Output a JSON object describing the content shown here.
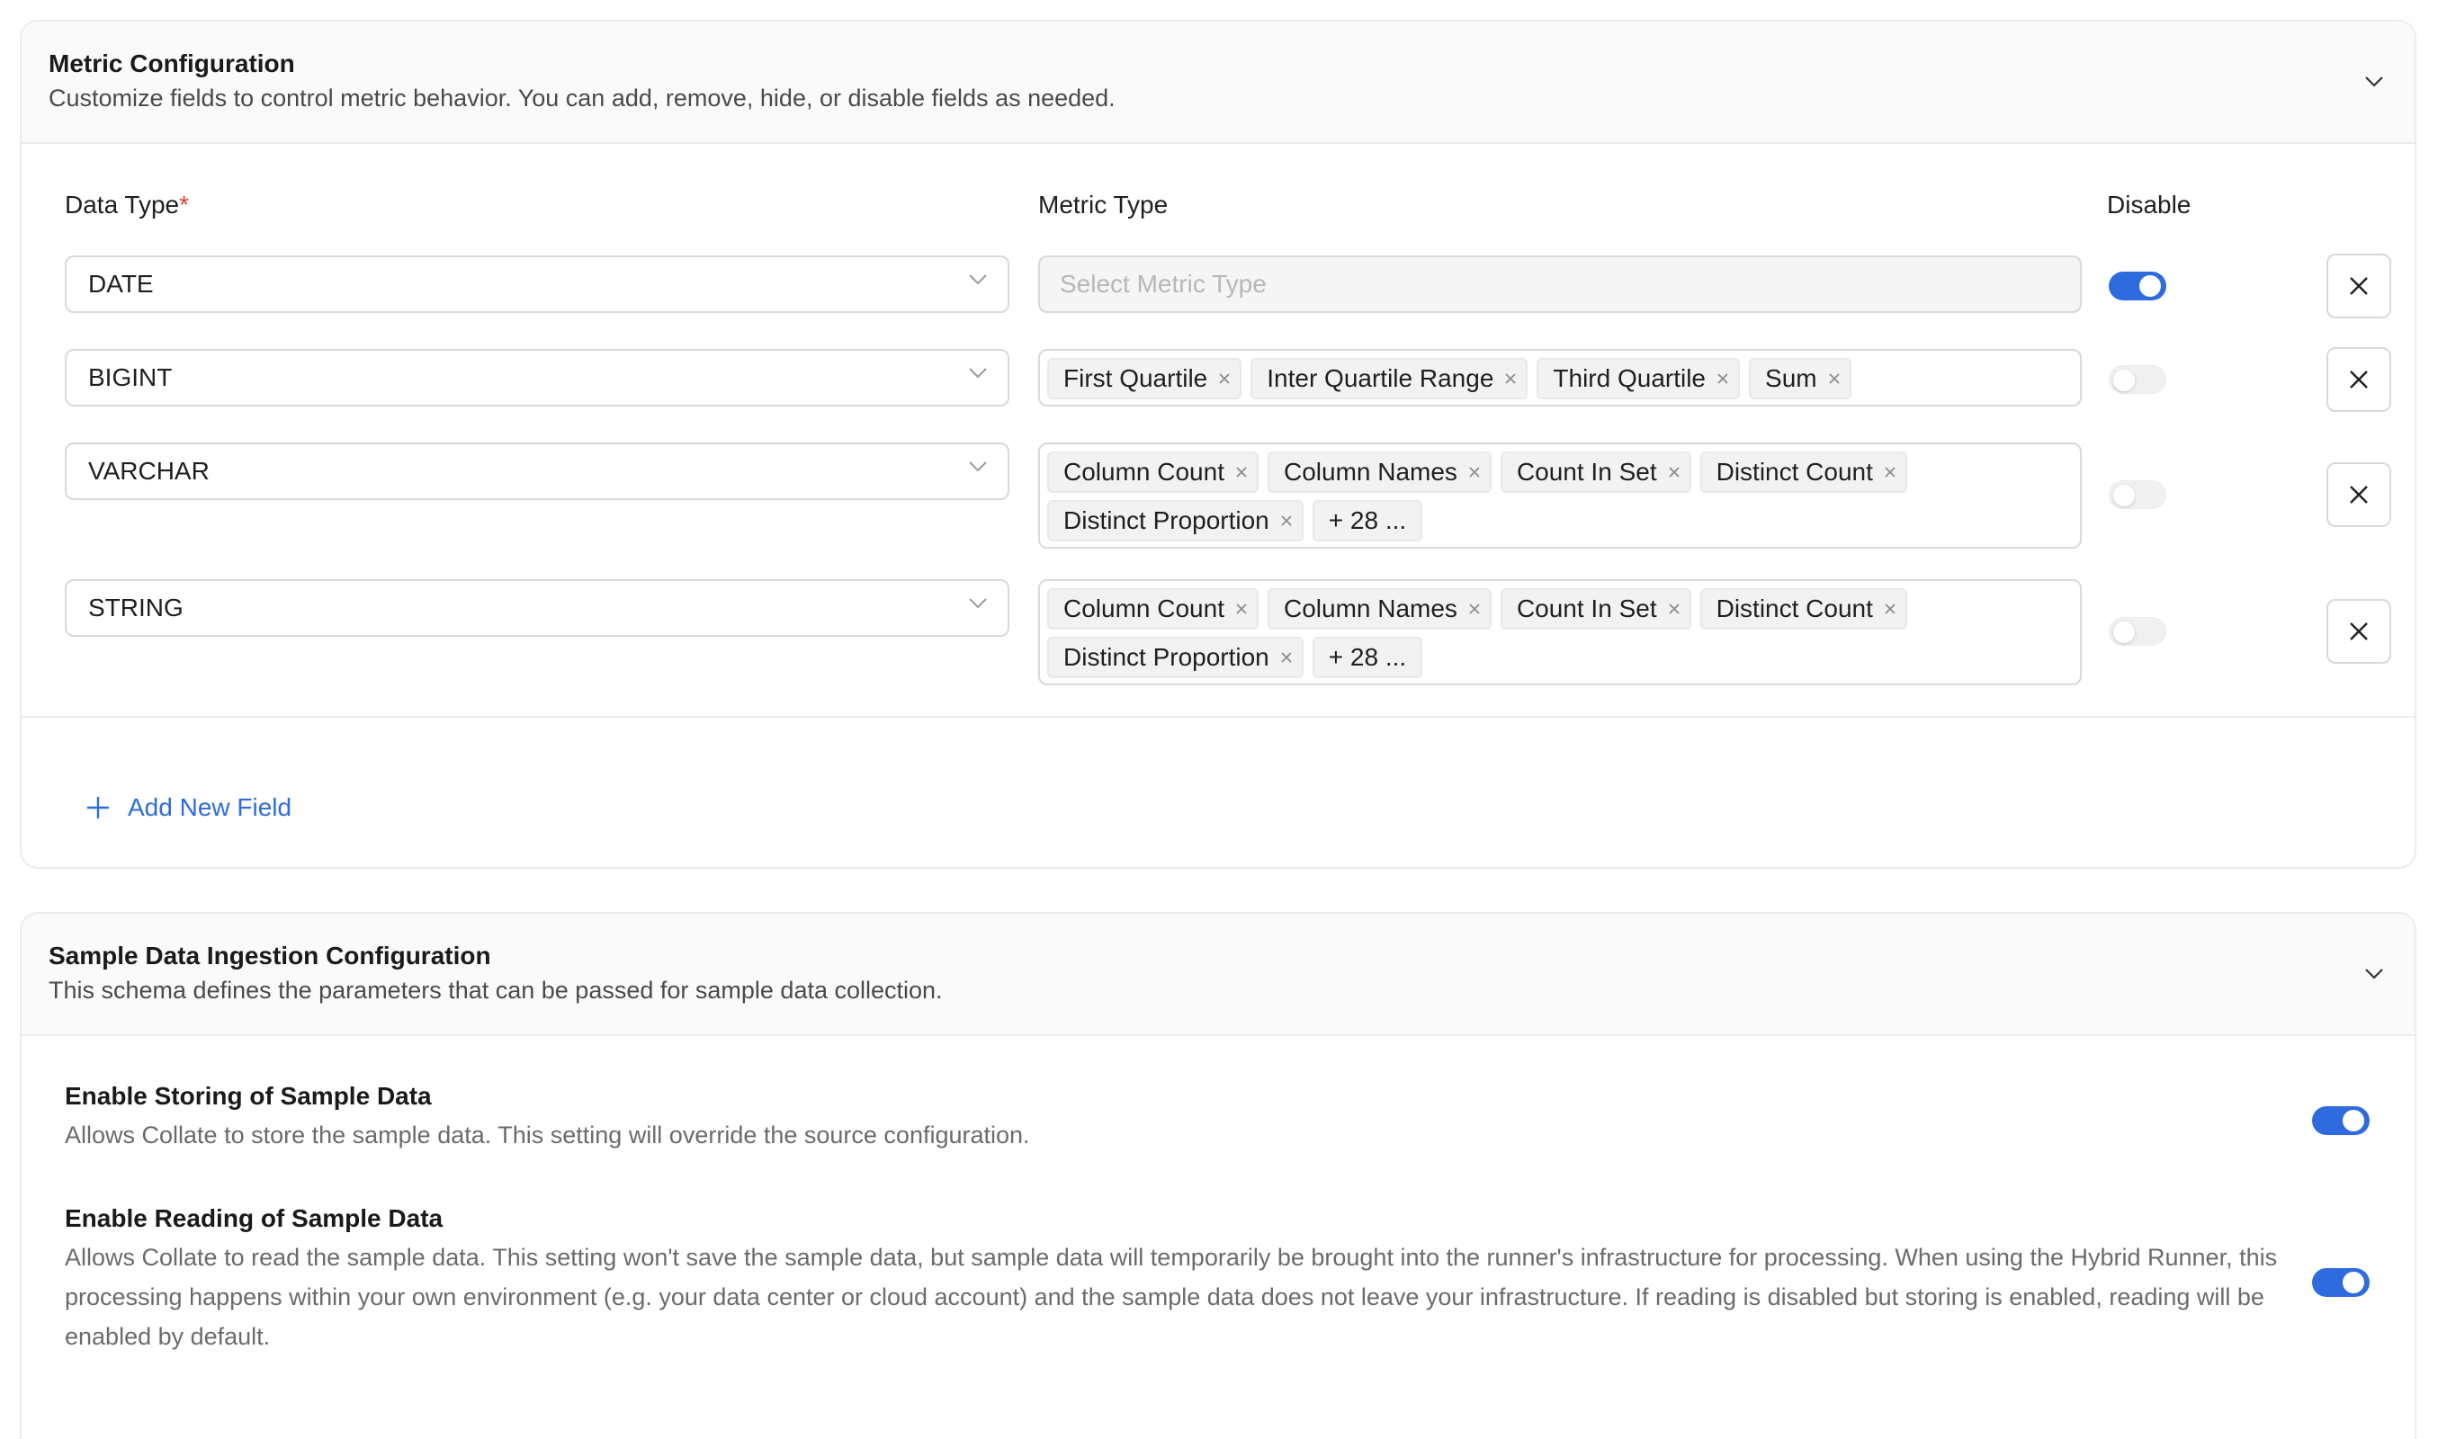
{
  "metric_config": {
    "title": "Metric Configuration",
    "description": "Customize fields to control metric behavior. You can add, remove, hide, or disable fields as needed.",
    "columns": {
      "data_type": "Data Type",
      "required_mark": "*",
      "metric_type": "Metric Type",
      "disable": "Disable"
    },
    "rows": [
      {
        "data_type": "DATE",
        "placeholder": "Select Metric Type",
        "tags": [],
        "more": "",
        "disabled": true
      },
      {
        "data_type": "BIGINT",
        "placeholder": "",
        "tags": [
          "First Quartile",
          "Inter Quartile Range",
          "Third Quartile",
          "Sum"
        ],
        "more": "",
        "disabled": false
      },
      {
        "data_type": "VARCHAR",
        "placeholder": "",
        "tags": [
          "Column Count",
          "Column Names",
          "Count In Set",
          "Distinct Count",
          "Distinct Proportion"
        ],
        "more": "+ 28 ...",
        "disabled": false
      },
      {
        "data_type": "STRING",
        "placeholder": "",
        "tags": [
          "Column Count",
          "Column Names",
          "Count In Set",
          "Distinct Count",
          "Distinct Proportion"
        ],
        "more": "+ 28 ...",
        "disabled": false
      }
    ],
    "add_field_label": "Add New Field"
  },
  "sample_config": {
    "title": "Sample Data Ingestion Configuration",
    "description": "This schema defines the parameters that can be passed for sample data collection.",
    "settings": [
      {
        "title": "Enable Storing of Sample Data",
        "description": "Allows Collate to store the sample data. This setting will override the source configuration.",
        "enabled": true
      },
      {
        "title": "Enable Reading of Sample Data",
        "description": "Allows Collate to read the sample data. This setting won't save the sample data, but sample data will temporarily be brought into the runner's infrastructure for processing. When using the Hybrid Runner, this processing happens within your own environment (e.g. your data center or cloud account) and the sample data does not leave your infrastructure. If reading is disabled but storing is enabled, reading will be enabled by default.",
        "enabled": true
      }
    ]
  },
  "icons": {
    "collapse": "chevron-down-icon",
    "select": "chevron-down-icon",
    "tag_remove": "close-icon",
    "row_remove": "close-icon",
    "add": "plus-icon"
  },
  "colors": {
    "accent": "#2e6bdf",
    "required": "#e53935"
  }
}
